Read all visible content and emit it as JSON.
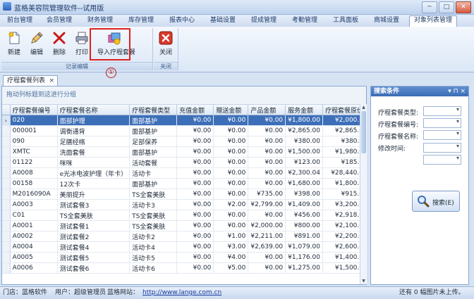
{
  "window": {
    "title": "蓝格美容院管理软件--试用版"
  },
  "menu": {
    "items": [
      "前台管理",
      "会员管理",
      "财务管理",
      "库存管理",
      "报表中心",
      "基础设置",
      "提成管理",
      "考勤管理",
      "工具面板",
      "商城设置",
      "对象列表管理"
    ],
    "active": "对象列表管理"
  },
  "ribbon": {
    "record_group": {
      "label": "记录编辑",
      "buttons": [
        "新建",
        "编辑",
        "删除",
        "打印",
        "导入疗程套餐"
      ]
    },
    "close_group": {
      "label": "关闭",
      "buttons": [
        "关闭"
      ]
    },
    "annotation": "①"
  },
  "doc_tab": {
    "label": "疗程套餐列表"
  },
  "grid": {
    "group_hint": "拖动列标题到这进行分组",
    "columns": [
      "疗程套餐编号",
      "疗程套餐名称",
      "疗程套餐类型",
      "充值金额",
      "赠送金额",
      "产品金额",
      "服务金额",
      "疗程套餐原价"
    ],
    "rows": [
      [
        "020",
        "面部护理",
        "面部基护",
        "¥0.00",
        "¥0.00",
        "¥0.00",
        "¥1,800.00",
        "¥2,000.0"
      ],
      [
        "000001",
        "调衡通背",
        "面部基护",
        "¥0.00",
        "¥0.00",
        "¥0.00",
        "¥2,865.00",
        "¥2,865.0"
      ],
      [
        "090",
        "足膳经络",
        "足部保养",
        "¥0.00",
        "¥0.00",
        "¥0.00",
        "¥380.00",
        "¥380.0"
      ],
      [
        "XMTC",
        "洗面套餐",
        "面部基护",
        "¥0.00",
        "¥0.00",
        "¥0.00",
        "¥1,500.00",
        "¥1,980.0"
      ],
      [
        "01122",
        "咪咪",
        "活动套餐",
        "¥0.00",
        "¥0.00",
        "¥0.00",
        "¥123.00",
        "¥185.0"
      ],
      [
        "A0008",
        "e光冰电波护理（年卡）",
        "活动卡",
        "¥0.00",
        "¥0.00",
        "¥0.00",
        "¥2,300.04",
        "¥28,440.0"
      ],
      [
        "00158",
        "12次卡",
        "面部基护",
        "¥0.00",
        "¥0.00",
        "¥0.00",
        "¥1,680.00",
        "¥1,800.0"
      ],
      [
        "M2016090A",
        "美丽提升",
        "TS全套美肤",
        "¥0.00",
        "¥0.00",
        "¥735.00",
        "¥398.00",
        "¥915.0"
      ],
      [
        "A0003",
        "测试套餐3",
        "活动卡3",
        "¥0.00",
        "¥2.00",
        "¥2,799.00",
        "¥1,409.00",
        "¥3,200.0"
      ],
      [
        "C01",
        "TS全套美肤",
        "TS全套美肤",
        "¥0.00",
        "¥0.00",
        "¥0.00",
        "¥456.00",
        "¥2,918.0"
      ],
      [
        "A0001",
        "测试套餐1",
        "TS全套美肤",
        "¥0.00",
        "¥0.00",
        "¥2,000.00",
        "¥800.00",
        "¥2,100.0"
      ],
      [
        "A0002",
        "测试套餐2",
        "活动卡2",
        "¥0.00",
        "¥1.00",
        "¥2,211.00",
        "¥891.00",
        "¥2,200.0"
      ],
      [
        "A0004",
        "测试套餐4",
        "活动卡4",
        "¥0.00",
        "¥3.00",
        "¥2,639.00",
        "¥1,079.00",
        "¥2,600.0"
      ],
      [
        "A0005",
        "测试套餐5",
        "活动卡5",
        "¥0.00",
        "¥4.00",
        "¥0.00",
        "¥1,176.00",
        "¥1,400.0"
      ],
      [
        "A0006",
        "测试套餐6",
        "活动卡6",
        "¥0.00",
        "¥5.00",
        "¥0.00",
        "¥1,275.00",
        "¥1,500.0"
      ]
    ]
  },
  "search_panel": {
    "title": "搜索条件",
    "tools": "▾ ⊓ ×",
    "fields": [
      "疗程套餐类型:",
      "疗程套餐编号:",
      "疗程套餐名称:",
      "修改时间:"
    ],
    "button": "搜索(E)"
  },
  "status": {
    "store_label": "门店：蓝格软件",
    "user_label": "用户：超级管理员",
    "site_label": "蓝格网站：",
    "site_link": "http://www.lange.com.cn",
    "right_text": "还有 0 幅图片未上传。"
  },
  "colors": {
    "selection": "#3d6fb8",
    "panel_header": "#3b6cb4",
    "callout": "#e02020"
  }
}
